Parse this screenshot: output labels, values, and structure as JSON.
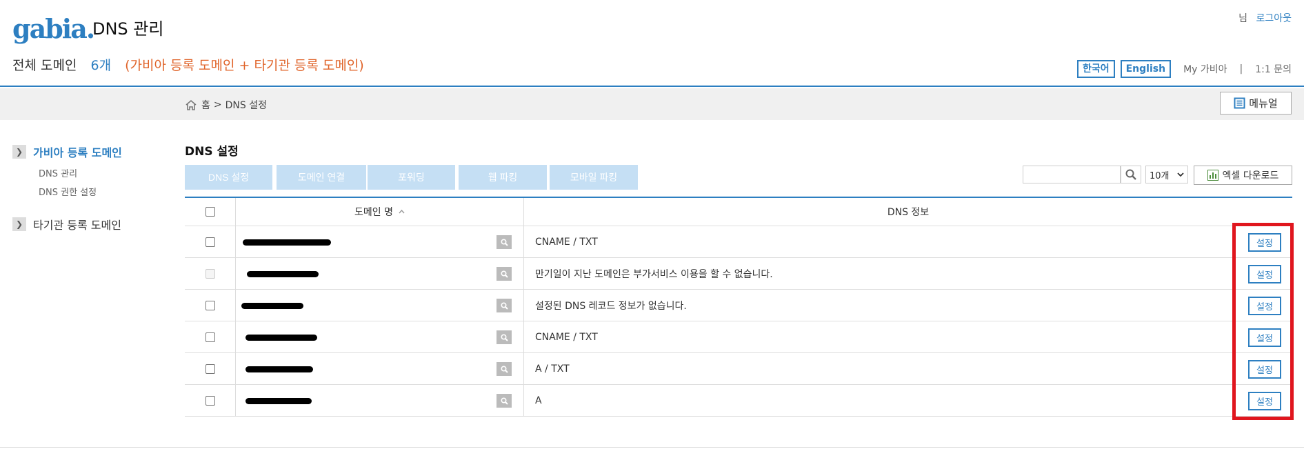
{
  "header": {
    "logo": "gabia.",
    "title": "DNS 관리",
    "total_label": "전체 도메인",
    "total_count": "6개",
    "total_desc": "(가비아 등록 도메인 + 타기관 등록 도메인)",
    "user_suffix": "님",
    "logout": "로그아웃",
    "lang_ko": "한국어",
    "lang_en": "English",
    "my_gabia": "My 가비아",
    "separator": "|",
    "inquiry": "1:1 문의"
  },
  "breadcrumb": {
    "home": "홈",
    "sep": ">",
    "current": "DNS 설정"
  },
  "manual_label": "메뉴얼",
  "sidebar": {
    "groups": [
      {
        "label": "가비아 등록 도메인",
        "items": [
          "DNS 관리",
          "DNS 권한 설정"
        ]
      },
      {
        "label": "타기관 등록 도메인",
        "items": []
      }
    ]
  },
  "content": {
    "section_title": "DNS 설정",
    "tabs": [
      "DNS 설정",
      "도메인 연결",
      "포워딩",
      "웹 파킹",
      "모바일 파킹"
    ],
    "search_placeholder": "",
    "page_size": "10개",
    "excel_label": "엑셀 다운로드"
  },
  "table": {
    "headers": {
      "domain": "도메인 명",
      "sort_icon": "chevron-up-icon",
      "dns": "DNS 정보"
    },
    "rows": [
      {
        "dns_info": "CNAME / TXT",
        "checkbox_disabled": false,
        "action": "설정"
      },
      {
        "dns_info": "만기일이 지난 도메인은 부가서비스 이용을 할 수 없습니다.",
        "checkbox_disabled": true,
        "action": "설정"
      },
      {
        "dns_info": "설정된 DNS 레코드 정보가 없습니다.",
        "checkbox_disabled": false,
        "action": "설정"
      },
      {
        "dns_info": "CNAME / TXT",
        "checkbox_disabled": false,
        "action": "설정"
      },
      {
        "dns_info": "A / TXT",
        "checkbox_disabled": false,
        "action": "설정"
      },
      {
        "dns_info": "A",
        "checkbox_disabled": false,
        "action": "설정"
      }
    ]
  },
  "colors": {
    "brand": "#2d7fc1",
    "accent_orange": "#e0642a",
    "highlight_red": "#e0161e",
    "tab_disabled": "#c5dff4"
  }
}
